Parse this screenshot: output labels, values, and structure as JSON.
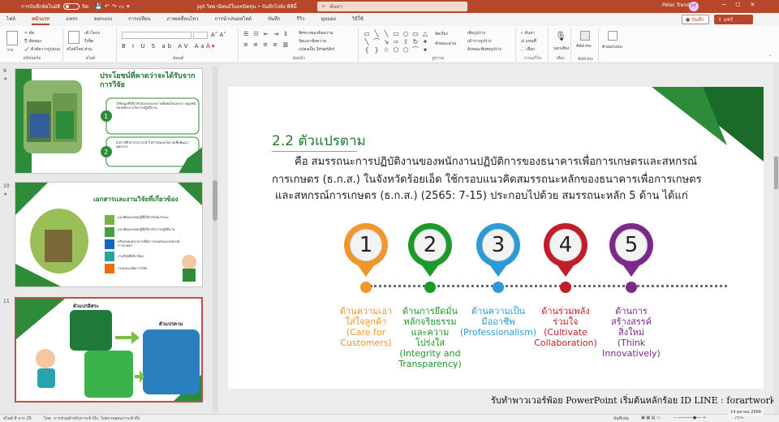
{
  "title_bar": {
    "autosave_label": "การบันทึกอัตโนมัติ",
    "autosave_state": "ปิด",
    "doc_title": "ppt วิทยานิพนธ์ในบทนิดหุ่น • บันทึกไปยัง พีซีนี้",
    "search_placeholder": "ค้นหา",
    "user_name": "Peter Trend",
    "user_initials": "PT"
  },
  "tabs": [
    "ไฟล์",
    "หน้าแรก",
    "แทรก",
    "ออกแบบ",
    "การเปลี่ยน",
    "ภาพเคลื่อนไหว",
    "การนำเสนอสไลด์",
    "บันทึก",
    "รีวิว",
    "มุมมอง",
    "วิธีใช้"
  ],
  "active_tab": "หน้าแรก",
  "tab_buttons": {
    "record": "บันทึก",
    "share": "แชร์"
  },
  "ribbon": {
    "clipboard": {
      "group": "คลิปบอร์ด",
      "paste": "วาง",
      "cut": "ตัด",
      "copy": "คัดลอก",
      "format_painter": "ตัวคัดวางรูปแบบ"
    },
    "slides": {
      "group": "สไลด์",
      "new_slide": "สไลด์ใหม่",
      "layout": "เค้าโครง",
      "reset": "รีเซ็ต",
      "section": "ส่วน"
    },
    "font": {
      "group": "ฟอนต์"
    },
    "paragraph": {
      "group": "ย่อหน้า",
      "text_direction": "ทิศทางของข้อความ",
      "align_text": "จัดแนวข้อความ",
      "smartart": "แปลงเป็น SmartArt"
    },
    "drawing": {
      "group": "รูปวาด",
      "arrange": "จัดเรียง",
      "quick_styles": "ลักษณะด่วน",
      "shape_fill": "เติมรูปร่าง",
      "shape_outline": "เค้าร่างรูปร่าง",
      "shape_effects": "ลักษณะพิเศษรูปร่าง"
    },
    "editing": {
      "group": "การแก้ไข",
      "find": "ค้นหา",
      "replace": "แทนที่",
      "select": "เลือก"
    },
    "voice": {
      "group": "เสียง",
      "dictate": "บอกเสียง"
    },
    "addins": {
      "group": "Add-ins",
      "label": "Add-ins"
    },
    "designer": {
      "group": "",
      "label": "ตัวออกแบบ"
    }
  },
  "thumbnails": [
    {
      "number": "9",
      "title": "ประโยชน์ที่คาดว่าจะได้รับจาก การวิจัย",
      "items": [
        "ได้ข้อมูลที่เกี่ยวกับสมรรถนะความพึงพอใจและความผูกพันของพนักงานในการปฏิบัติงาน",
        "ผลการศึกษาสามารถนำไปกำหนดนโยบายเพื่อพัฒนาบุคลากร"
      ]
    },
    {
      "number": "10",
      "title": "เอกสารและงานวิจัยที่เกี่ยวข้อง",
      "items": [
        "แนวคิดและทฤษฎีที่เกี่ยวกับสมรรถนะ",
        "แนวคิดและทฤษฎีที่เกี่ยวกับการปฏิบัติงาน",
        "บริบทของธนาคารเพื่อการเกษตรและสหกรณ์การเกษตร",
        "งานวิจัยที่เกี่ยวข้อง",
        "กรอบแนวคิดการวิจัย"
      ]
    },
    {
      "number": "11",
      "title": "ตัวแปรอิสระ",
      "subtitle": "ตัวแปรตาม"
    }
  ],
  "slide": {
    "heading": "2.2 ตัวแปรตาม",
    "body_lines": [
      "คือ สมรรถนะการปฏิบัติงานของพนักงานปฏิบัติการของธนาคารเพื่อการเกษตรและสหกรณ์",
      "การเกษตร (ธ.ก.ส.) ในจังหวัดร้อยเอ็ด ใช้กรอบแนวคิดสมรรถนะหลักของธนาคารเพื่อการเกษตร",
      "และสหกรณ์การเกษตร (ธ.ก.ส.) (2565: 7-15) ประกอบไปด้วย สมรรถนะหลัก 5 ด้าน ได้แก่"
    ],
    "competencies": [
      {
        "number": "1",
        "label": "ด้านความเอาใส่ใจลูกค้า (Care for Customers)",
        "lines": [
          "ด้านความเอา",
          "ใส่ใจลูกค้า",
          "(Care for",
          "Customers)"
        ],
        "color": "#f0962a"
      },
      {
        "number": "2",
        "label": "ด้านการยึดมั่นหลักจริยธรรมและความโปร่งใส (Integrity and Transparency)",
        "lines": [
          "ด้านการยึดมั่น",
          "หลักจริยธรรม",
          "และความ",
          "โปร่งใส",
          "(Integrity and",
          "Transparency)"
        ],
        "color": "#1a9a28"
      },
      {
        "number": "3",
        "label": "ด้านความเป็นมืออาชีพ (Professionalism)",
        "lines": [
          "ด้านความเป็น",
          "มืออาชีพ",
          "(Professionalism)"
        ],
        "color": "#2b9ad6"
      },
      {
        "number": "4",
        "label": "ด้านร่วมพลังร่วมใจ (Cultivate Collaboration)",
        "lines": [
          "ด้านร่วมพลัง",
          "ร่วมใจ",
          "(Cultivate",
          "Collaboration)"
        ],
        "color": "#c21d2a"
      },
      {
        "number": "5",
        "label": "ด้านการสร้างสรรค์สิ่งใหม่ (Think Innovatively)",
        "lines": [
          "ด้านการ",
          "สร้างสรรค์",
          "สิ่งใหม่",
          "(Think",
          "Innovatively)"
        ],
        "color": "#7b2a8c"
      }
    ]
  },
  "watermark": "รับทำพาวเวอร์พ้อย PowerPoint เริ่มต้นหลักร้อย ID LINE : forartwork",
  "status_bar": {
    "slide_counter": "สไลด์ 8 จาก 25",
    "language": "ไทย",
    "accessibility": "การช่วยสำหรับการเข้าถึง: ไปตรวจสอบการเข้าถึง",
    "notes": "บันทึกย่อ",
    "zoom": "75%"
  },
  "taskbar_date": "14 ตุลาคม 2566",
  "colors": {
    "accent": "#b7472a",
    "green": "#1e7a2a"
  }
}
